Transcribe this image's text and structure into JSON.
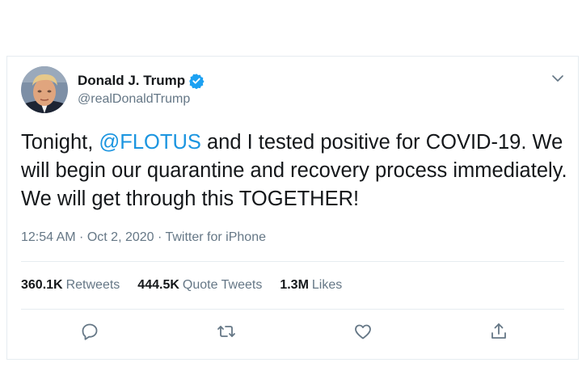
{
  "tweet": {
    "author": {
      "name": "Donald J. Trump",
      "handle": "@realDonaldTrump",
      "verified": true
    },
    "text": {
      "part1": "Tonight, ",
      "mention": "@FLOTUS",
      "part2": " and I tested positive for COVID-19. We will begin our quarantine and recovery process immediately. We will get through this TOGETHER!"
    },
    "meta": {
      "time": "12:54 AM",
      "sep1": " · ",
      "date": "Oct 2, 2020",
      "sep2": " · ",
      "source": "Twitter for iPhone"
    },
    "stats": {
      "retweets_count": "360.1K",
      "retweets_label": "Retweets",
      "quotes_count": "444.5K",
      "quotes_label": "Quote Tweets",
      "likes_count": "1.3M",
      "likes_label": "Likes"
    },
    "icons": {
      "more": "chevron-down-icon",
      "reply": "reply-icon",
      "retweet": "retweet-icon",
      "like": "heart-icon",
      "share": "share-icon"
    },
    "colors": {
      "link": "#1b95e0",
      "verified": "#1da1f2",
      "muted": "#657786",
      "text": "#14171a",
      "border": "#e6ecf0"
    }
  }
}
